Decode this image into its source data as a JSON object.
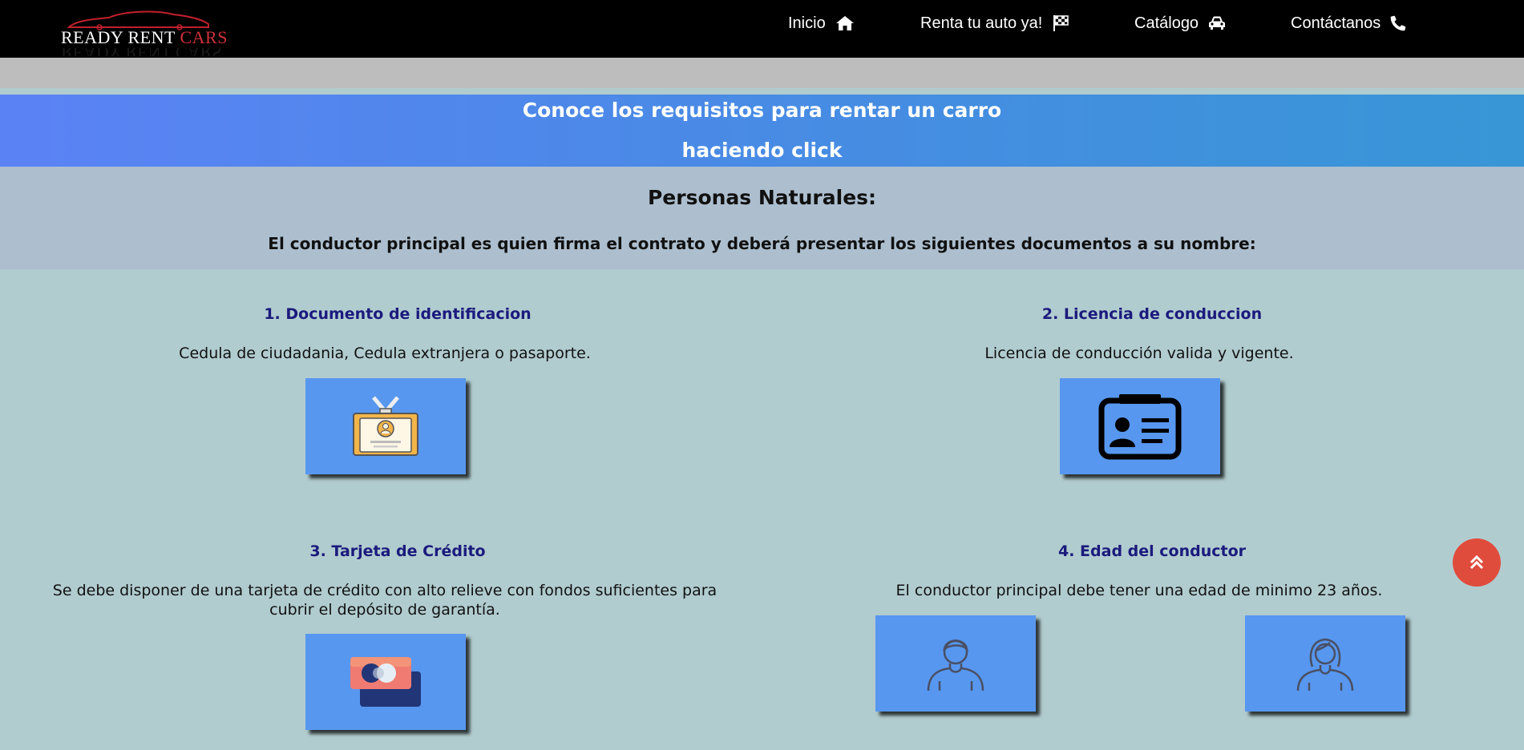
{
  "brand": {
    "name_part1": "READY RENT ",
    "name_part2": "CARS",
    "accent_color": "#d0303a"
  },
  "nav": [
    {
      "label": "Inicio",
      "icon": "home-icon"
    },
    {
      "label": "Renta tu auto ya!",
      "icon": "checkered-flag-icon"
    },
    {
      "label": "Catálogo",
      "icon": "car-icon"
    },
    {
      "label": "Contáctanos",
      "icon": "phone-icon"
    }
  ],
  "banner": {
    "line1": "Conoce los requisitos para rentar un carro",
    "line2": "haciendo click"
  },
  "section": {
    "title": "Personas Naturales:",
    "subtitle": "El conductor principal es quien firma el contrato y deberá presentar los siguientes documentos a su nombre:"
  },
  "requirements": [
    {
      "title": "1. Documento de identificacion",
      "text": "Cedula de ciudadania, Cedula extranjera o pasaporte.",
      "icon": "id-badge-icon"
    },
    {
      "title": "2. Licencia de conduccion",
      "text": "Licencia de conducción valida y vigente.",
      "icon": "driver-license-icon"
    },
    {
      "title": "3. Tarjeta de Crédito",
      "text": "Se debe disponer de una tarjeta de crédito con alto relieve con fondos suficientes para cubrir el depósito de garantía.",
      "icon": "credit-card-icon"
    },
    {
      "title": "4. Edad del conductor",
      "text": "El conductor principal debe tener una edad de minimo 23 años.",
      "icon": "person-icon"
    }
  ],
  "colors": {
    "page_bg": "#b1cccf",
    "requirement_title": "#1b1a7d",
    "card_bg": "#5797ef",
    "scroll_button": "#e04c3c"
  },
  "scroll_top": {
    "icon": "double-chevron-up-icon"
  }
}
